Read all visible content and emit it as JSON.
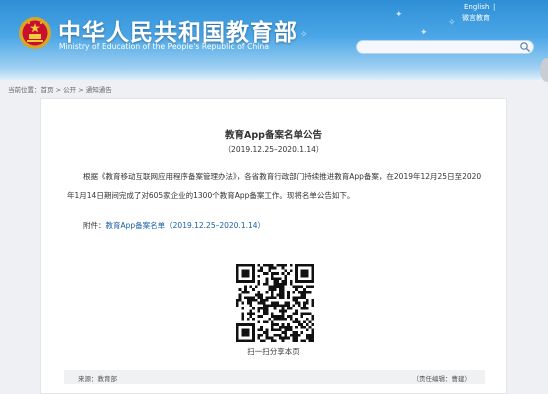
{
  "header": {
    "title": "中华人民共和国教育部",
    "subtitle": "Ministry of Education of the People's Republic of China",
    "lang_link": "English",
    "lang_sep": "|",
    "weibo_link": "微言教育",
    "search_placeholder": "",
    "brand_color": "#2f8fd6"
  },
  "breadcrumb": {
    "prefix": "当前位置：",
    "items": [
      "首页",
      "公开",
      "通知通告"
    ],
    "separator": ">"
  },
  "article": {
    "title": "教育App备案名单公告",
    "date_range": "（2019.12.25–2020.1.14）",
    "body": "根据《教育移动互联网应用程序备案管理办法》，各省教育行政部门持续推进教育App备案，在2019年12月25日至2020年1月14日期间完成了对605家企业的1300个教育App备案工作。现将名单公告如下。",
    "attachment_label": "附件：",
    "attachment_link": "教育App备案名单（2019.12.25–2020.1.14）",
    "qr_caption": "扫一扫分享本页",
    "source": "来源：教育部",
    "editor": "（责任编辑：曹建）",
    "link_color": "#1a5fa8"
  },
  "icons": {
    "emblem": "national-emblem-icon",
    "search": "search-icon",
    "qr": "qr-code-icon"
  }
}
